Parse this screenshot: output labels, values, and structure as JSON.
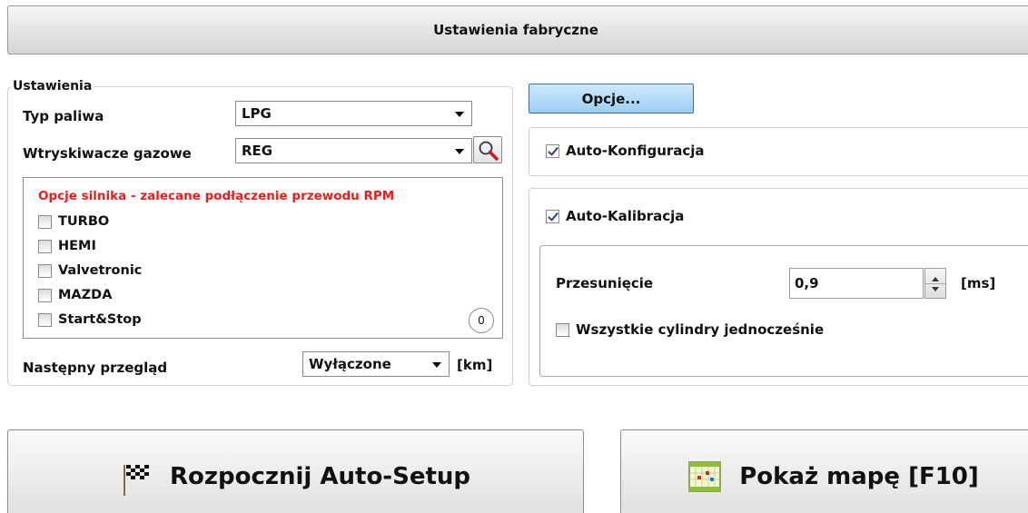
{
  "header": {
    "title": "Ustawienia fabryczne"
  },
  "settings": {
    "group_title": "Ustawienia",
    "fuel_label": "Typ paliwa",
    "fuel_value": "LPG",
    "injectors_label": "Wtryskiwacze gazowe",
    "injectors_value": "REG",
    "engine_options_title": "Opcje silnika - zalecane podłączenie przewodu RPM",
    "engine_options": [
      {
        "label": "TURBO",
        "checked": false
      },
      {
        "label": "HEMI",
        "checked": false
      },
      {
        "label": "Valvetronic",
        "checked": false
      },
      {
        "label": "MAZDA",
        "checked": false
      },
      {
        "label": "Start&Stop",
        "checked": false
      }
    ],
    "counter": "0",
    "service_label": "Następny przegląd",
    "service_value": "Wyłączone",
    "service_unit": "[km]"
  },
  "options": {
    "button_label": "Opcje...",
    "auto_config_label": "Auto-Konfiguracja",
    "auto_config_checked": true,
    "auto_calibration_label": "Auto-Kalibracja",
    "auto_calibration_checked": true,
    "offset_label": "Przesunięcie",
    "offset_value": "0,9",
    "offset_unit": "[ms]",
    "all_cylinders_label": "Wszystkie cylindry jednocześnie",
    "all_cylinders_checked": false
  },
  "actions": {
    "auto_setup_label": "Rozpocznij Auto-Setup",
    "auto_setup_icon": "checkered-flag-icon",
    "show_map_label": "Pokaż mapę [F10]",
    "show_map_icon": "map-chart-icon"
  }
}
